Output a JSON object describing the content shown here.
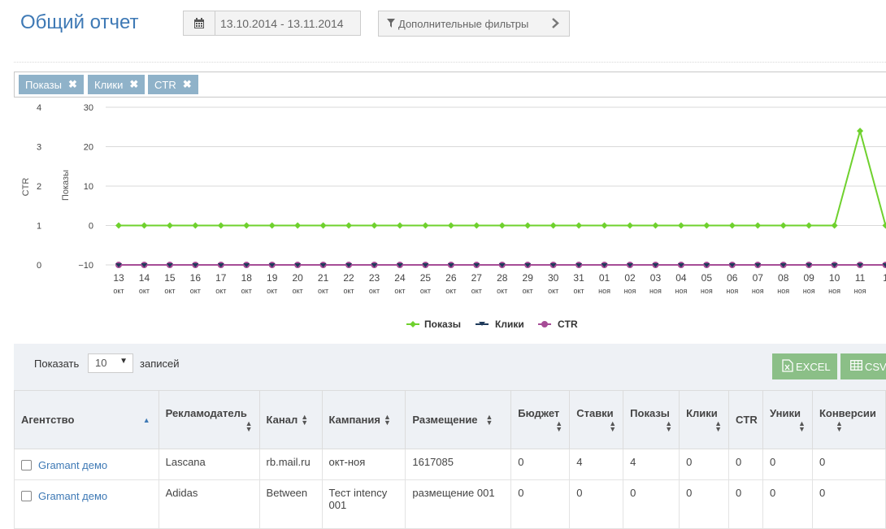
{
  "header": {
    "title": "Общий отчет",
    "date_range": "13.10.2014 - 13.11.2014",
    "filters_label": "Дополнительные фильтры"
  },
  "tags": [
    {
      "label": "Показы"
    },
    {
      "label": "Клики"
    },
    {
      "label": "CTR"
    }
  ],
  "chart_data": {
    "type": "line",
    "ylabel_left": "CTR",
    "ylabel_right": "Показы",
    "y_ctr_ticks": [
      "4",
      "3",
      "2",
      "1",
      "0"
    ],
    "y_shows_ticks": [
      "30",
      "20",
      "10",
      "0",
      "−10"
    ],
    "x_days": [
      "13",
      "14",
      "15",
      "16",
      "17",
      "18",
      "19",
      "20",
      "21",
      "22",
      "23",
      "24",
      "25",
      "26",
      "27",
      "28",
      "29",
      "30",
      "31",
      "01",
      "02",
      "03",
      "04",
      "05",
      "06",
      "07",
      "08",
      "09",
      "10",
      "11",
      "1"
    ],
    "x_months": [
      "окт",
      "окт",
      "окт",
      "окт",
      "окт",
      "окт",
      "окт",
      "окт",
      "окт",
      "окт",
      "окт",
      "окт",
      "окт",
      "окт",
      "окт",
      "окт",
      "окт",
      "окт",
      "окт",
      "ноя",
      "ноя",
      "ноя",
      "ноя",
      "ноя",
      "ноя",
      "ноя",
      "ноя",
      "ноя",
      "ноя",
      "ноя",
      ""
    ],
    "series": [
      {
        "name": "Показы",
        "color": "#6fd12e",
        "values": [
          0,
          0,
          0,
          0,
          0,
          0,
          0,
          0,
          0,
          0,
          0,
          0,
          0,
          0,
          0,
          0,
          0,
          0,
          0,
          0,
          0,
          0,
          0,
          0,
          0,
          0,
          0,
          0,
          0,
          24,
          0
        ]
      },
      {
        "name": "Клики",
        "color": "#1f3a5a",
        "values": [
          0,
          0,
          0,
          0,
          0,
          0,
          0,
          0,
          0,
          0,
          0,
          0,
          0,
          0,
          0,
          0,
          0,
          0,
          0,
          0,
          0,
          0,
          0,
          0,
          0,
          0,
          0,
          0,
          0,
          0,
          0
        ]
      },
      {
        "name": "CTR",
        "color": "#a64c96",
        "values": [
          0,
          0,
          0,
          0,
          0,
          0,
          0,
          0,
          0,
          0,
          0,
          0,
          0,
          0,
          0,
          0,
          0,
          0,
          0,
          0,
          0,
          0,
          0,
          0,
          0,
          0,
          0,
          0,
          0,
          0,
          0
        ]
      }
    ],
    "grid": true,
    "legend_position": "bottom"
  },
  "table_controls": {
    "show_label": "Показать",
    "page_length": "10",
    "records_label": "записей",
    "excel_label": "EXCEL",
    "csv_label": "CSV"
  },
  "table": {
    "headers": [
      "Агентство",
      "Рекламодатель",
      "Канал",
      "Кампания",
      "Размещение",
      "Бюджет",
      "Ставки",
      "Показы",
      "Клики",
      "CTR",
      "Уники",
      "Конверсии"
    ],
    "rows": [
      [
        "Gramant демо",
        "Lascana",
        "rb.mail.ru",
        "окт-ноя",
        "1617085",
        "0",
        "4",
        "4",
        "0",
        "0",
        "0",
        "0"
      ],
      [
        "Gramant демо",
        "Adidas",
        "Between",
        "Тест intency 001",
        "размещение 001",
        "0",
        "0",
        "0",
        "0",
        "0",
        "0",
        "0"
      ]
    ]
  },
  "colors": {
    "accent": "#3e79b5",
    "tag": "#8fb2c9",
    "export_button": "#8bbf87"
  }
}
